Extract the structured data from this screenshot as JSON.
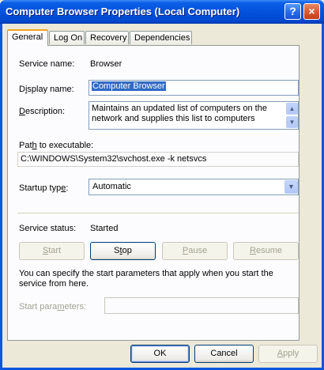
{
  "window": {
    "title": "Computer Browser Properties (Local Computer)",
    "help_label": "?",
    "close_label": "×"
  },
  "tabs": [
    {
      "label": "General",
      "active": true
    },
    {
      "label": "Log On"
    },
    {
      "label": "Recovery"
    },
    {
      "label": "Dependencies"
    }
  ],
  "general": {
    "service_name_label": "Service name:",
    "service_name_value": "Browser",
    "display_name_label_pre": "D",
    "display_name_label_mn": "i",
    "display_name_label_post": "splay name:",
    "display_name_value": "Computer Browser",
    "description_label_mn": "D",
    "description_label_post": "escription:",
    "description_value": "Maintains an updated list of computers on the network and supplies this list to computers",
    "path_label_pre": "Pat",
    "path_label_mn": "h",
    "path_label_post": " to executable:",
    "path_value": "C:\\WINDOWS\\System32\\svchost.exe -k netsvcs",
    "startup_type_label_pre": "Startup typ",
    "startup_type_label_mn": "e",
    "startup_type_label_post": ":",
    "startup_type_value": "Automatic",
    "service_status_label": "Service status:",
    "service_status_value": "Started",
    "start_label_mn": "S",
    "start_label_post": "tart",
    "stop_label_pre": "S",
    "stop_label_mn": "t",
    "stop_label_post": "op",
    "pause_label_mn": "P",
    "pause_label_post": "ause",
    "resume_label_mn": "R",
    "resume_label_post": "esume",
    "info_text": "You can specify the start parameters that apply when you start the service from here.",
    "start_params_label_pre": "Start para",
    "start_params_label_mn": "m",
    "start_params_label_post": "eters:",
    "start_params_value": ""
  },
  "footer": {
    "ok_label": "OK",
    "cancel_label": "Cancel",
    "apply_label_mn": "A",
    "apply_label_post": "pply"
  },
  "icons": {
    "scroll_up": "▲",
    "scroll_down": "▼",
    "combo_arrow": "▼"
  }
}
